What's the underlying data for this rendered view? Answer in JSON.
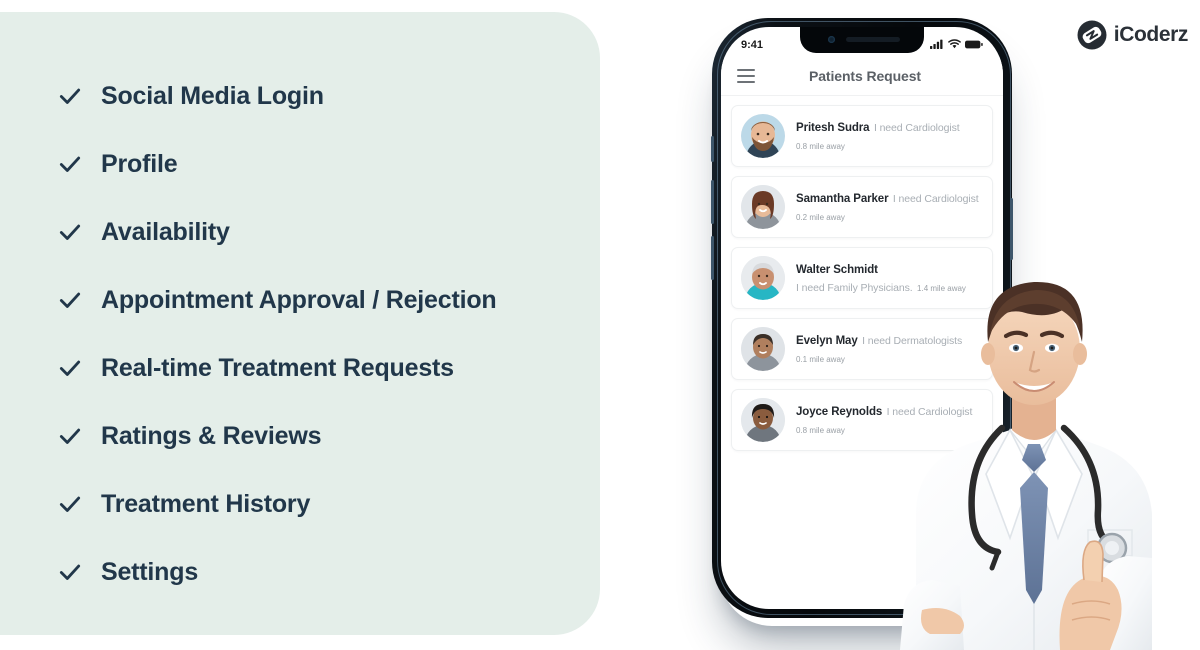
{
  "brand": {
    "name": "iCoderz",
    "logo_icon": "icoderz-logo-icon",
    "logo_circle_color": "#262c33"
  },
  "theme": {
    "panel_bg": "#e4eee9",
    "text_dark": "#21374a",
    "page_bg": "#ffffff",
    "accent_check": "#21374a"
  },
  "features": {
    "check_icon": "check-icon",
    "items": [
      {
        "label": "Social Media Login"
      },
      {
        "label": "Profile"
      },
      {
        "label": "Availability"
      },
      {
        "label": "Appointment Approval / Rejection"
      },
      {
        "label": "Real-time Treatment Requests"
      },
      {
        "label": "Ratings & Reviews"
      },
      {
        "label": "Treatment History"
      },
      {
        "label": "Settings"
      }
    ]
  },
  "phone": {
    "status_bar": {
      "time": "9:41",
      "icons": [
        "cellular-signal-icon",
        "wifi-icon",
        "battery-icon"
      ]
    },
    "app": {
      "menu_icon": "hamburger-menu-icon",
      "title": "Patients Request",
      "patients": [
        {
          "name": "Pritesh Sudra",
          "need": "I need Cardiologist",
          "distance": "0.8 mile away",
          "avatar": "avatar-bearded-man"
        },
        {
          "name": "Samantha Parker",
          "need": "I need Cardiologist",
          "distance": "0.2 mile away",
          "avatar": "avatar-young-woman"
        },
        {
          "name": "Walter Schmidt",
          "need": "I need Family Physicians.",
          "distance": "1.4 mile away",
          "avatar": "avatar-senior-man"
        },
        {
          "name": "Evelyn May",
          "need": "I need Dermatologists",
          "distance": "0.1 mile away",
          "avatar": "avatar-woman-grey"
        },
        {
          "name": "Joyce Reynolds",
          "need": "I need Cardiologist",
          "distance": "0.8 mile away",
          "avatar": "avatar-woman-dark-hair"
        }
      ]
    }
  },
  "doctor": {
    "description": "smiling-male-doctor-thumbs-up"
  }
}
